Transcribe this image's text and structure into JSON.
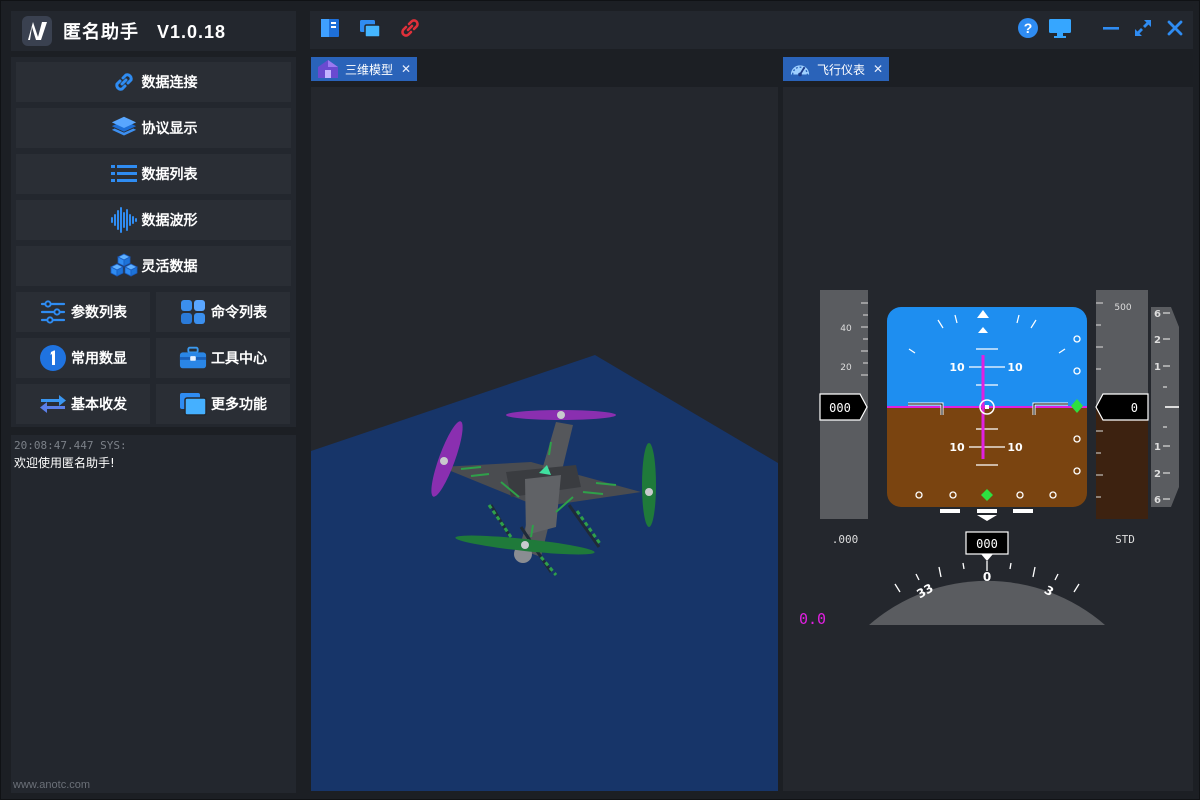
{
  "app": {
    "title": "匿名助手   V1.0.18"
  },
  "menu": {
    "items": [
      {
        "label": "数据连接",
        "icon": "link-icon"
      },
      {
        "label": "协议显示",
        "icon": "layers-icon"
      },
      {
        "label": "数据列表",
        "icon": "list-icon"
      },
      {
        "label": "数据波形",
        "icon": "waveform-icon"
      },
      {
        "label": "灵活数据",
        "icon": "cubes-icon"
      },
      {
        "label": "参数列表",
        "icon": "sliders-icon"
      },
      {
        "label": "命令列表",
        "icon": "grid-icon"
      },
      {
        "label": "常用数显",
        "icon": "number-one-icon"
      },
      {
        "label": "工具中心",
        "icon": "toolbox-icon"
      },
      {
        "label": "基本收发",
        "icon": "swap-arrows-icon"
      },
      {
        "label": "更多功能",
        "icon": "windows-icon"
      }
    ]
  },
  "log": {
    "timestamp": "20:08:47.447 SYS:",
    "message": "欢迎使用匿名助手!",
    "url": "www.anotc.com"
  },
  "tabs": {
    "model3d": "三维模型",
    "flight": "飞行仪表"
  },
  "instrument": {
    "speed_box": "000",
    "alt_box": "0",
    "heading_box": "000",
    "speed_ticks": [
      "40",
      "20"
    ],
    "alt_tick": "500",
    "vs_ticks": [
      "6",
      "2",
      "1",
      "1",
      "2",
      "6"
    ],
    "pitch_labels": [
      "10",
      "10",
      "10",
      "10"
    ],
    "speed_below": ".000",
    "alt_below": "STD",
    "heading_labels": [
      "33",
      "0",
      "3"
    ],
    "mach": "0.0"
  },
  "colors": {
    "tab": "#2a63b9",
    "sky": "#1e8ef0",
    "ground": "#7a4410",
    "horizon": "#e020e0",
    "floor": "#173569"
  }
}
